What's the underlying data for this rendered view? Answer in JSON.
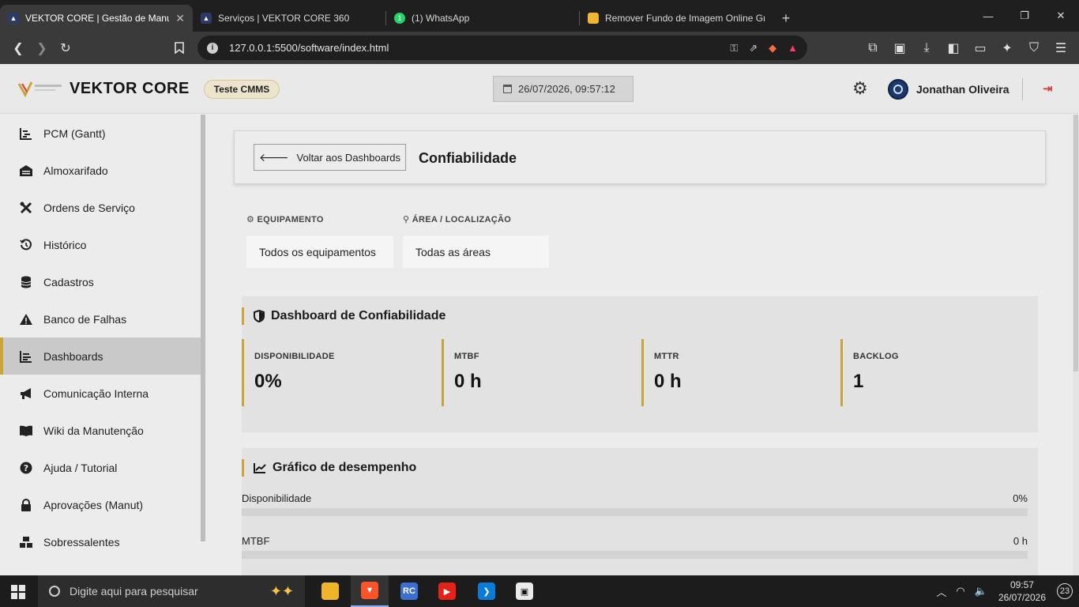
{
  "browser": {
    "tabs": [
      {
        "title": "VEKTOR CORE | Gestão de Manutenção",
        "active": true,
        "color": "#2b3a67"
      },
      {
        "title": "Serviços | VEKTOR CORE 360",
        "active": false,
        "color": "#2b3a67"
      },
      {
        "title": "(1) WhatsApp",
        "active": false,
        "color": "#25d366",
        "badge": "1"
      },
      {
        "title": "Remover Fundo de Imagem Online Grátis",
        "active": false,
        "color": "#f2b632"
      }
    ],
    "url": "127.0.0.1:5500/software/index.html"
  },
  "header": {
    "brand": "VEKTOR CORE",
    "env_badge": "Teste CMMS",
    "datetime": "26/07/2026, 09:57:12",
    "user_name": "Jonathan Oliveira"
  },
  "sidebar": {
    "items": [
      {
        "label": "PCM (Gantt)",
        "icon": "gantt-icon"
      },
      {
        "label": "Almoxarifado",
        "icon": "warehouse-icon"
      },
      {
        "label": "Ordens de Serviço",
        "icon": "tools-icon"
      },
      {
        "label": "Histórico",
        "icon": "history-icon"
      },
      {
        "label": "Cadastros",
        "icon": "database-icon"
      },
      {
        "label": "Banco de Falhas",
        "icon": "warning-icon"
      },
      {
        "label": "Dashboards",
        "icon": "chart-icon",
        "active": true
      },
      {
        "label": "Comunicação Interna",
        "icon": "megaphone-icon"
      },
      {
        "label": "Wiki da Manutenção",
        "icon": "book-icon"
      },
      {
        "label": "Ajuda / Tutorial",
        "icon": "question-icon"
      },
      {
        "label": "Aprovações (Manut)",
        "icon": "lock-icon"
      },
      {
        "label": "Sobressalentes",
        "icon": "boxes-icon"
      }
    ]
  },
  "main": {
    "back_button": "Voltar aos Dashboards",
    "page_title": "Confiabilidade",
    "filters": {
      "equipment_label": "EQUIPAMENTO",
      "equipment_value": "Todos os equipamentos",
      "area_label": "ÁREA / LOCALIZAÇÃO",
      "area_value": "Todas as áreas"
    },
    "reliability": {
      "title": "Dashboard de Confiabilidade",
      "kpis": [
        {
          "label": "DISPONIBILIDADE",
          "value": "0%"
        },
        {
          "label": "MTBF",
          "value": "0 h"
        },
        {
          "label": "MTTR",
          "value": "0 h"
        },
        {
          "label": "BACKLOG",
          "value": "1"
        }
      ]
    },
    "performance": {
      "title": "Gráfico de desempenho",
      "rows": [
        {
          "label": "Disponibilidade",
          "value": "0%",
          "fraction": 0
        },
        {
          "label": "MTBF",
          "value": "0 h",
          "fraction": 0
        }
      ]
    }
  },
  "taskbar": {
    "search_placeholder": "Digite aqui para pesquisar",
    "time": "09:57",
    "date": "26/07/2026",
    "notifications": "23"
  },
  "colors": {
    "accent": "#c9a43a",
    "logout": "#dd3333"
  }
}
